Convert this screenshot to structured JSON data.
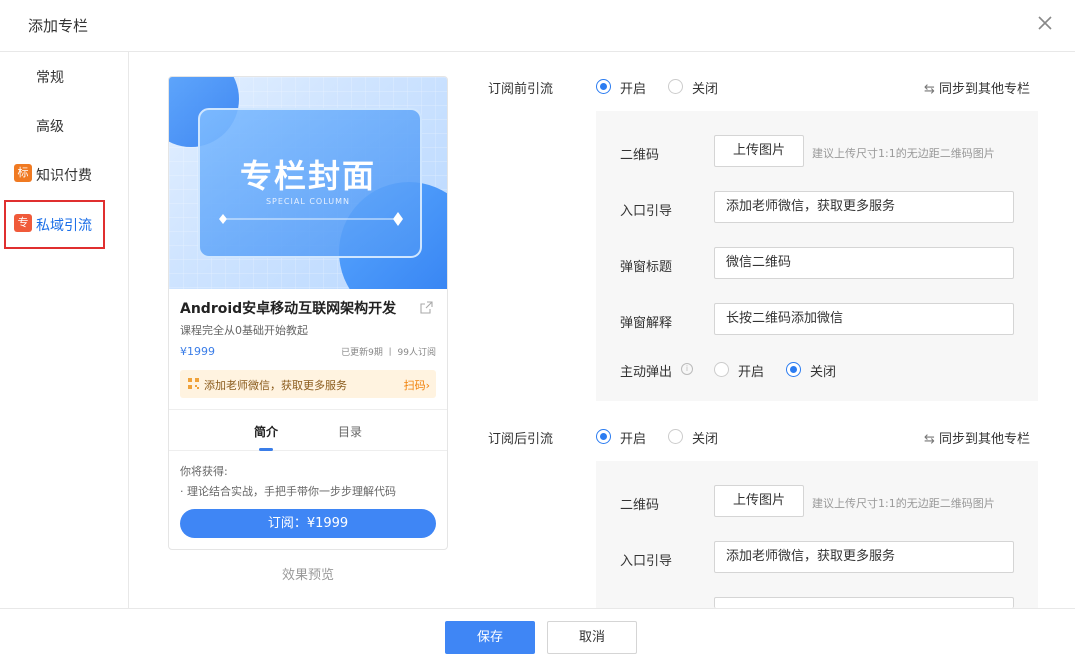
{
  "dialog": {
    "title": "添加专栏"
  },
  "sidebar": {
    "items": [
      {
        "label": "常规"
      },
      {
        "label": "高级"
      },
      {
        "label": "知识付费",
        "badge": "标",
        "badge_color": "#f07a22"
      },
      {
        "label": "私域引流",
        "badge": "专",
        "badge_color": "#f05a3a"
      }
    ]
  },
  "preview": {
    "cover_title": "专栏封面",
    "cover_subtitle": "SPECIAL COLUMN",
    "course_title": "Android安卓移动互联网架构开发",
    "course_desc": "课程完全从0基础开始教起",
    "price": "¥1999",
    "stats": "已更新9期 丨 99人订阅",
    "wx_text": "添加老师微信，获取更多服务",
    "wx_action": "扫码",
    "tabs": [
      "简介",
      "目录"
    ],
    "intro_head": "你将获得:",
    "intro_line": "· 理论结合实战，手把手带你一步步理解代码",
    "subscribe": "订阅：¥1999",
    "caption": "效果预览"
  },
  "before": {
    "label": "订阅前引流",
    "on": "开启",
    "off": "关闭",
    "sync": "同步到其他专栏",
    "qr_label": "二维码",
    "upload": "上传图片",
    "hint": "建议上传尺寸1:1的无边距二维码图片",
    "entry_label": "入口引导",
    "entry_value": "添加老师微信，获取更多服务",
    "popup_title_label": "弹窗标题",
    "popup_title_value": "微信二维码",
    "popup_desc_label": "弹窗解释",
    "popup_desc_value": "长按二维码添加微信",
    "auto_label": "主动弹出",
    "auto_on": "开启",
    "auto_off": "关闭"
  },
  "after": {
    "label": "订阅后引流",
    "on": "开启",
    "off": "关闭",
    "sync": "同步到其他专栏",
    "qr_label": "二维码",
    "upload": "上传图片",
    "hint": "建议上传尺寸1:1的无边距二维码图片",
    "entry_label": "入口引导",
    "entry_value": "添加老师微信，获取更多服务"
  },
  "footer": {
    "save": "保存",
    "cancel": "取消"
  },
  "colors": {
    "accent": "#3f86f5",
    "active_nav_text": "#1c6fe8",
    "highlight_border": "#e02f2f"
  }
}
